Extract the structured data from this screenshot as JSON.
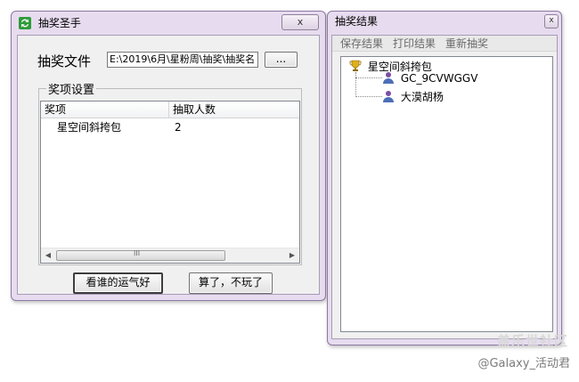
{
  "main_window": {
    "title": "抽奖圣手",
    "close_label": "x",
    "file_label": "抽奖文件",
    "file_path": "E:\\2019\\6月\\星粉周\\抽奖\\抽奖名",
    "browse_label": "...",
    "group_label": "奖项设置",
    "columns": [
      "奖项",
      "抽取人数"
    ],
    "rows": [
      {
        "prize": "星空间斜挎包",
        "count": "2"
      }
    ],
    "scroll_thumb_glyph": "III",
    "start_button": "看谁的运气好",
    "quit_button": "算了，不玩了"
  },
  "result_window": {
    "title": "抽奖结果",
    "close_label": "x",
    "menu": [
      "保存结果",
      "打印结果",
      "重新抽奖"
    ],
    "tree_root": "星空间斜挎包",
    "winners": [
      "GC_9CVWGGV",
      "大漠胡杨"
    ]
  },
  "watermark": {
    "line1": "盖乐世社区",
    "line2": "@Galaxy_活动君"
  },
  "colors": {
    "title_bg": "#e7dcef",
    "client_bg": "#f0f0f0",
    "menu_text": "#6a6a6a"
  },
  "icons": {
    "app_icon": "recycle-arrows-icon",
    "trophy": "trophy-icon",
    "winner": "person-icon"
  }
}
